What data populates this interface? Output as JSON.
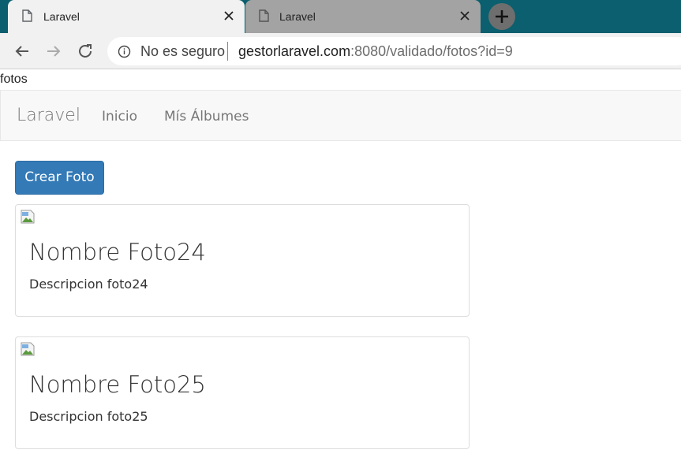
{
  "browser": {
    "tabs": [
      {
        "title": "Laravel",
        "active": true
      },
      {
        "title": "Laravel",
        "active": false
      }
    ],
    "address_bar": {
      "security_label": "No es seguro",
      "separator": "|",
      "url_host": "gestorlaravel.com",
      "url_rest": ":8080/validado/fotos?id=9"
    }
  },
  "page": {
    "raw_heading": "fotos",
    "navbar": {
      "brand": "Laravel",
      "links": [
        "Inicio",
        "Mís Álbumes"
      ]
    },
    "create_button_label": "Crear Foto",
    "photos": [
      {
        "title": "Nombre Foto24",
        "description": "Descripcion foto24"
      },
      {
        "title": "Nombre Foto25",
        "description": "Descripcion foto25"
      }
    ]
  },
  "colors": {
    "tabstrip": "#0b5f6e",
    "primary_button": "#337ab7",
    "navbar_bg": "#f8f8f8",
    "navbar_text": "#777777"
  }
}
